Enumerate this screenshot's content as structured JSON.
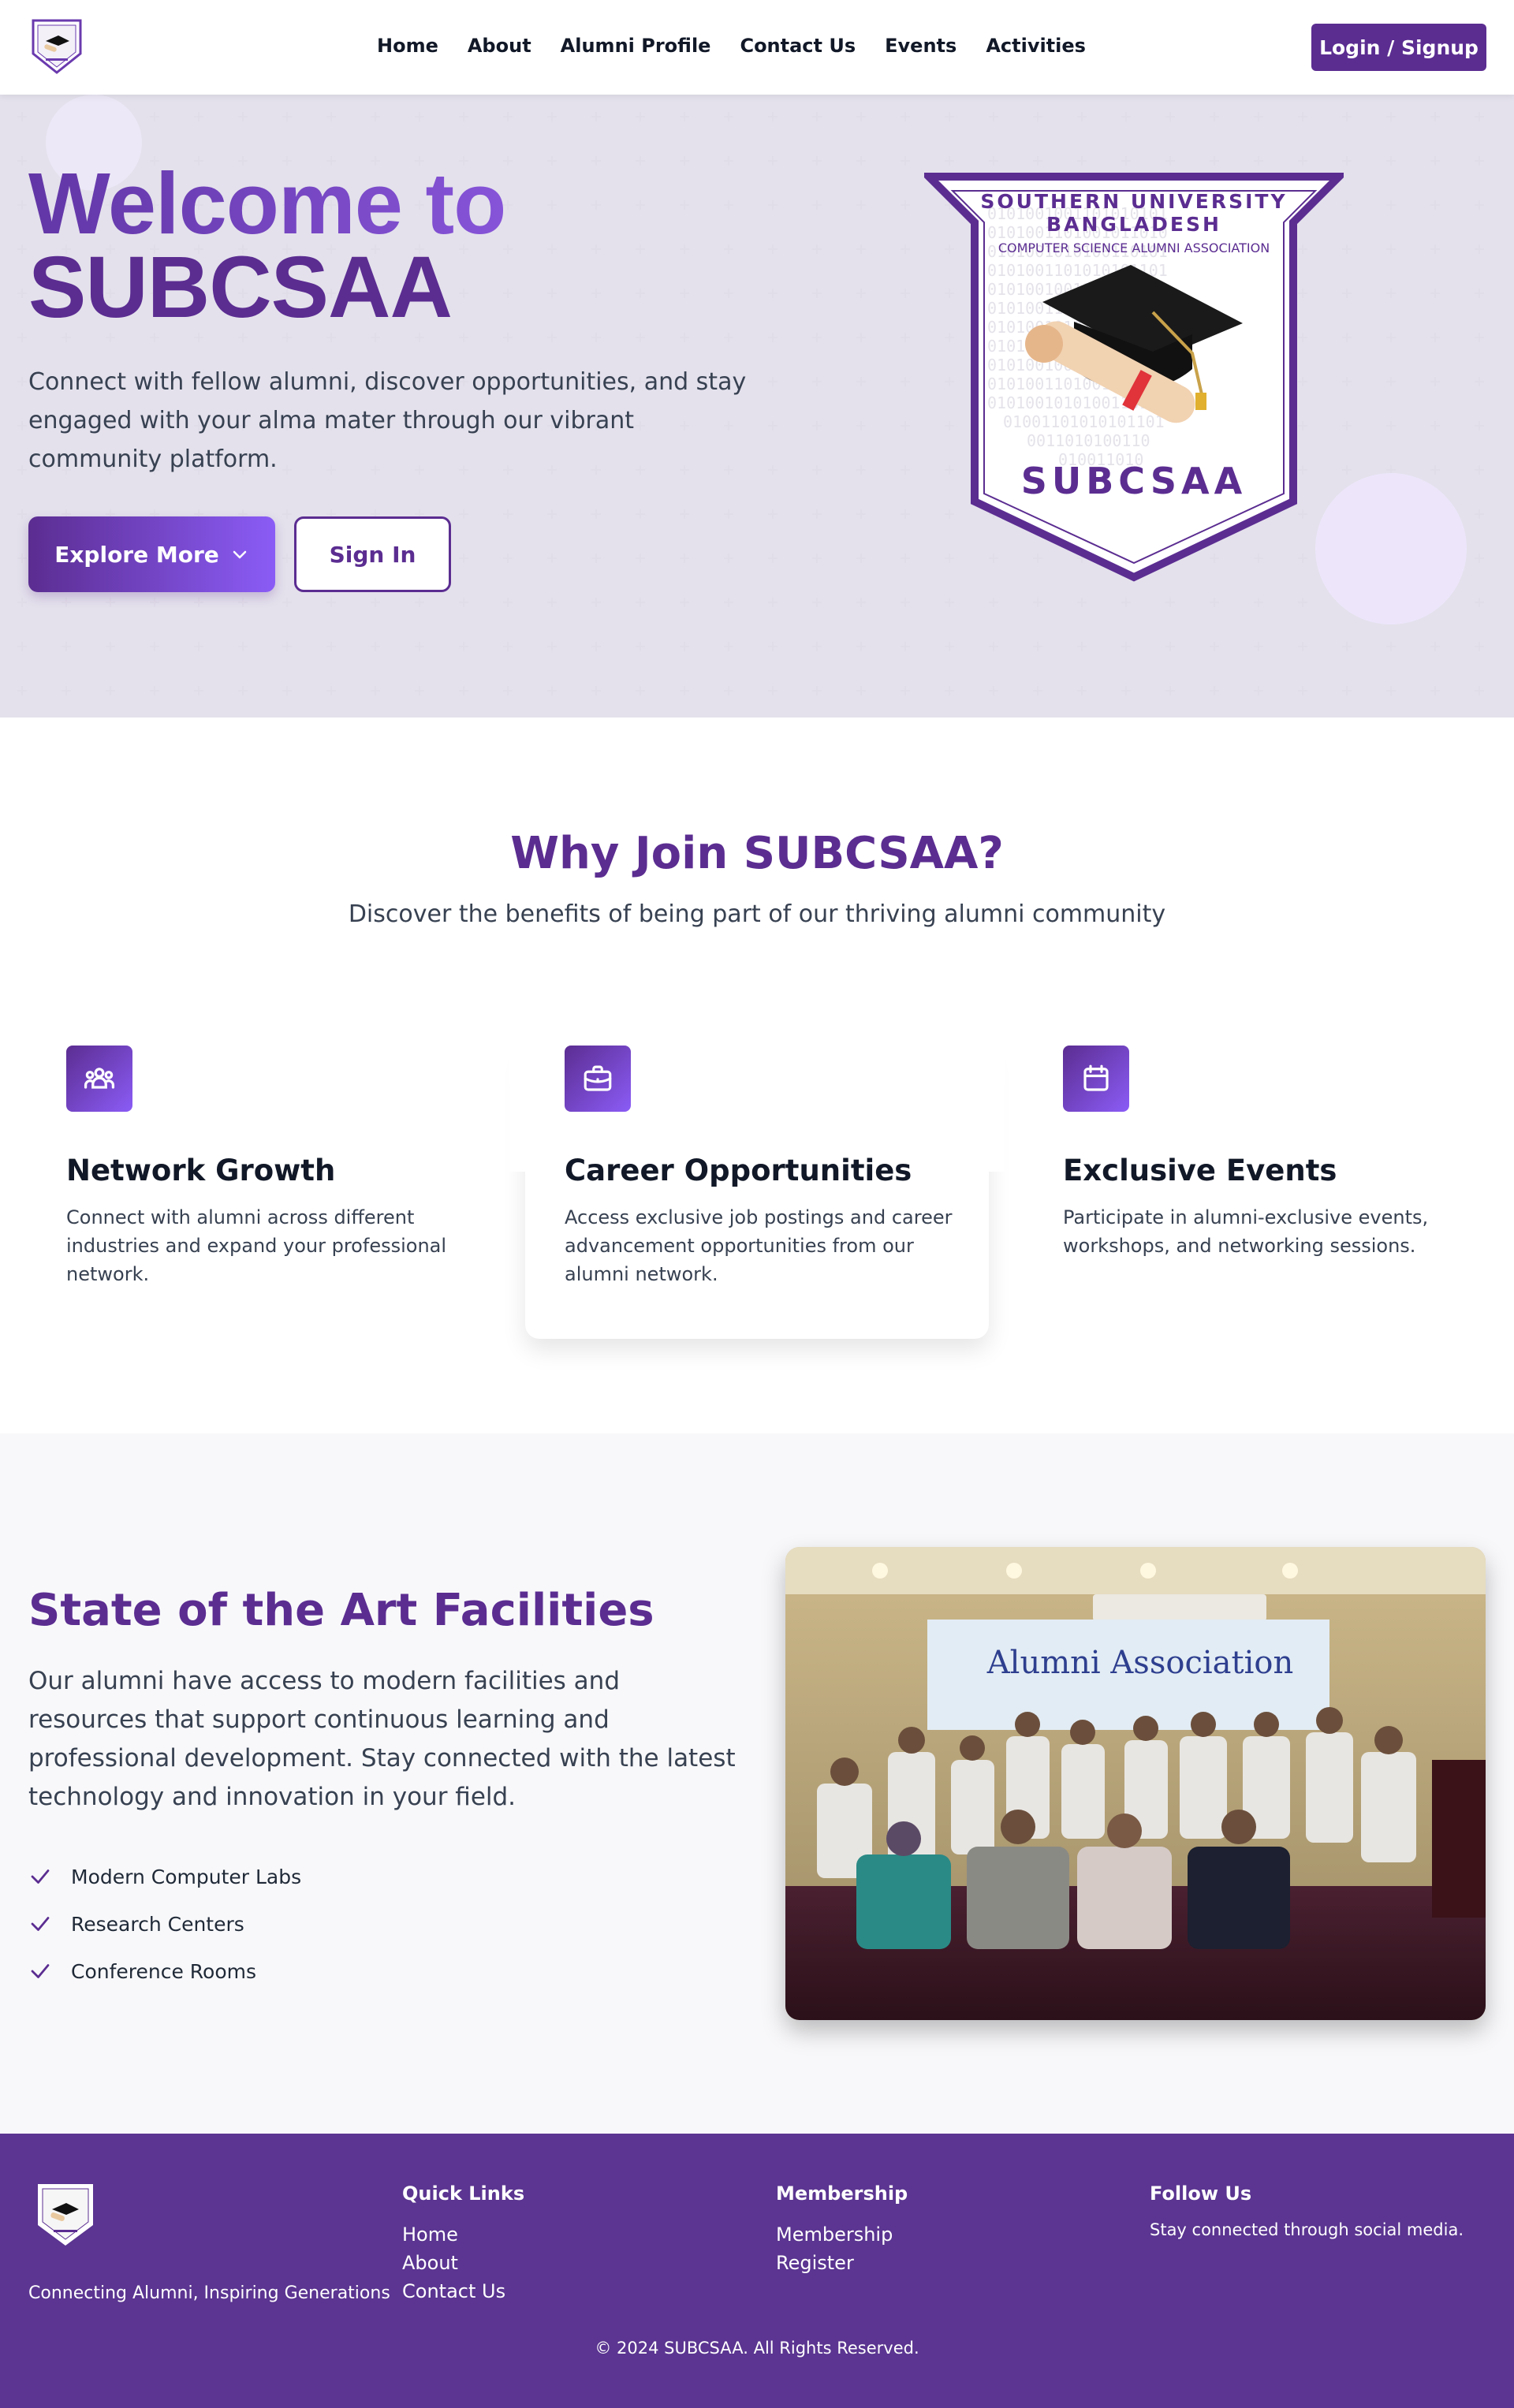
{
  "nav": {
    "links": [
      "Home",
      "About",
      "Alumni Profile",
      "Contact Us",
      "Events",
      "Activities"
    ],
    "login_label": "Login / Signup"
  },
  "hero": {
    "title_line1": "Welcome to",
    "title_line2": "SUBCSAA",
    "subtitle": "Connect with fellow alumni, discover opportunities, and stay engaged with your alma mater through our vibrant community platform.",
    "explore_label": "Explore More",
    "signin_label": "Sign In",
    "crest": {
      "line1": "SOUTHERN UNIVERSITY",
      "line2": "BANGLADESH",
      "line3": "COMPUTER SCIENCE ALUMNI ASSOCIATION",
      "name": "SUBCSAA"
    }
  },
  "why": {
    "title": "Why Join SUBCSAA?",
    "subtitle": "Discover the benefits of being part of our thriving alumni community",
    "cards": [
      {
        "icon": "users-icon",
        "title": "Network Growth",
        "text": "Connect with alumni across different industries and expand your professional network."
      },
      {
        "icon": "briefcase-icon",
        "title": "Career Opportunities",
        "text": "Access exclusive job postings and career advancement opportunities from our alumni network."
      },
      {
        "icon": "calendar-icon",
        "title": "Exclusive Events",
        "text": "Participate in alumni-exclusive events, workshops, and networking sessions."
      }
    ]
  },
  "facilities": {
    "title": "State of the Art Facilities",
    "text": "Our alumni have access to modern facilities and resources that support continuous learning and professional development. Stay connected with the latest technology and innovation in your field.",
    "items": [
      "Modern Computer Labs",
      "Research Centers",
      "Conference Rooms"
    ],
    "photo_banner": "Alumni Association"
  },
  "footer": {
    "tagline": "Connecting Alumni, Inspiring Generations",
    "quick_links_title": "Quick Links",
    "quick_links": [
      "Home",
      "About",
      "Contact Us"
    ],
    "membership_title": "Membership",
    "membership_links": [
      "Membership",
      "Register"
    ],
    "follow_title": "Follow Us",
    "follow_text": "Stay connected through social media.",
    "copyright": "© 2024 SUBCSAA. All Rights Reserved."
  },
  "colors": {
    "primary": "#5b2d91",
    "accent": "#8b5cf6",
    "footer_bg": "#5b3591",
    "hero_bg": "#f6f5f9"
  }
}
